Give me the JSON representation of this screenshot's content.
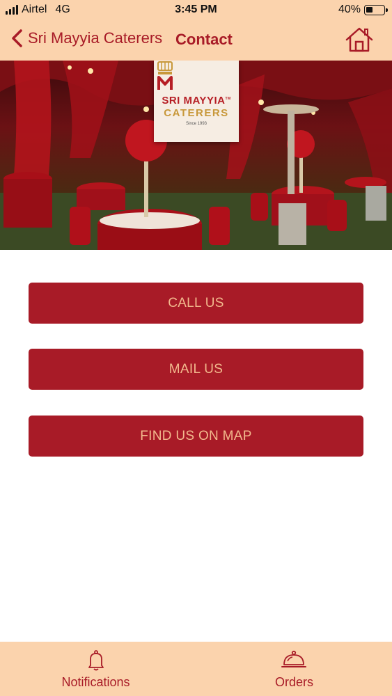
{
  "status_bar": {
    "carrier": "Airtel",
    "network": "4G",
    "time": "3:45 PM",
    "battery_text": "40%",
    "battery_level": 0.4
  },
  "header": {
    "back_label": "Sri Mayyia Caterers",
    "title": "Contact",
    "home_icon": "home-icon"
  },
  "hero": {
    "logo": {
      "line1": "SRI MAYYIA",
      "trademark": "TM",
      "line2": "CATERERS",
      "line3": "Since 1993"
    }
  },
  "actions": {
    "call_label": "CALL US",
    "mail_label": "MAIL US",
    "map_label": "FIND US ON MAP"
  },
  "tabbar": {
    "notifications_label": "Notifications",
    "notifications_icon": "bell-icon",
    "orders_label": "Orders",
    "orders_icon": "cloche-icon"
  },
  "colors": {
    "accent": "#a81b27",
    "header_bg": "#fbd3ad",
    "button_text": "#f2b98d"
  }
}
